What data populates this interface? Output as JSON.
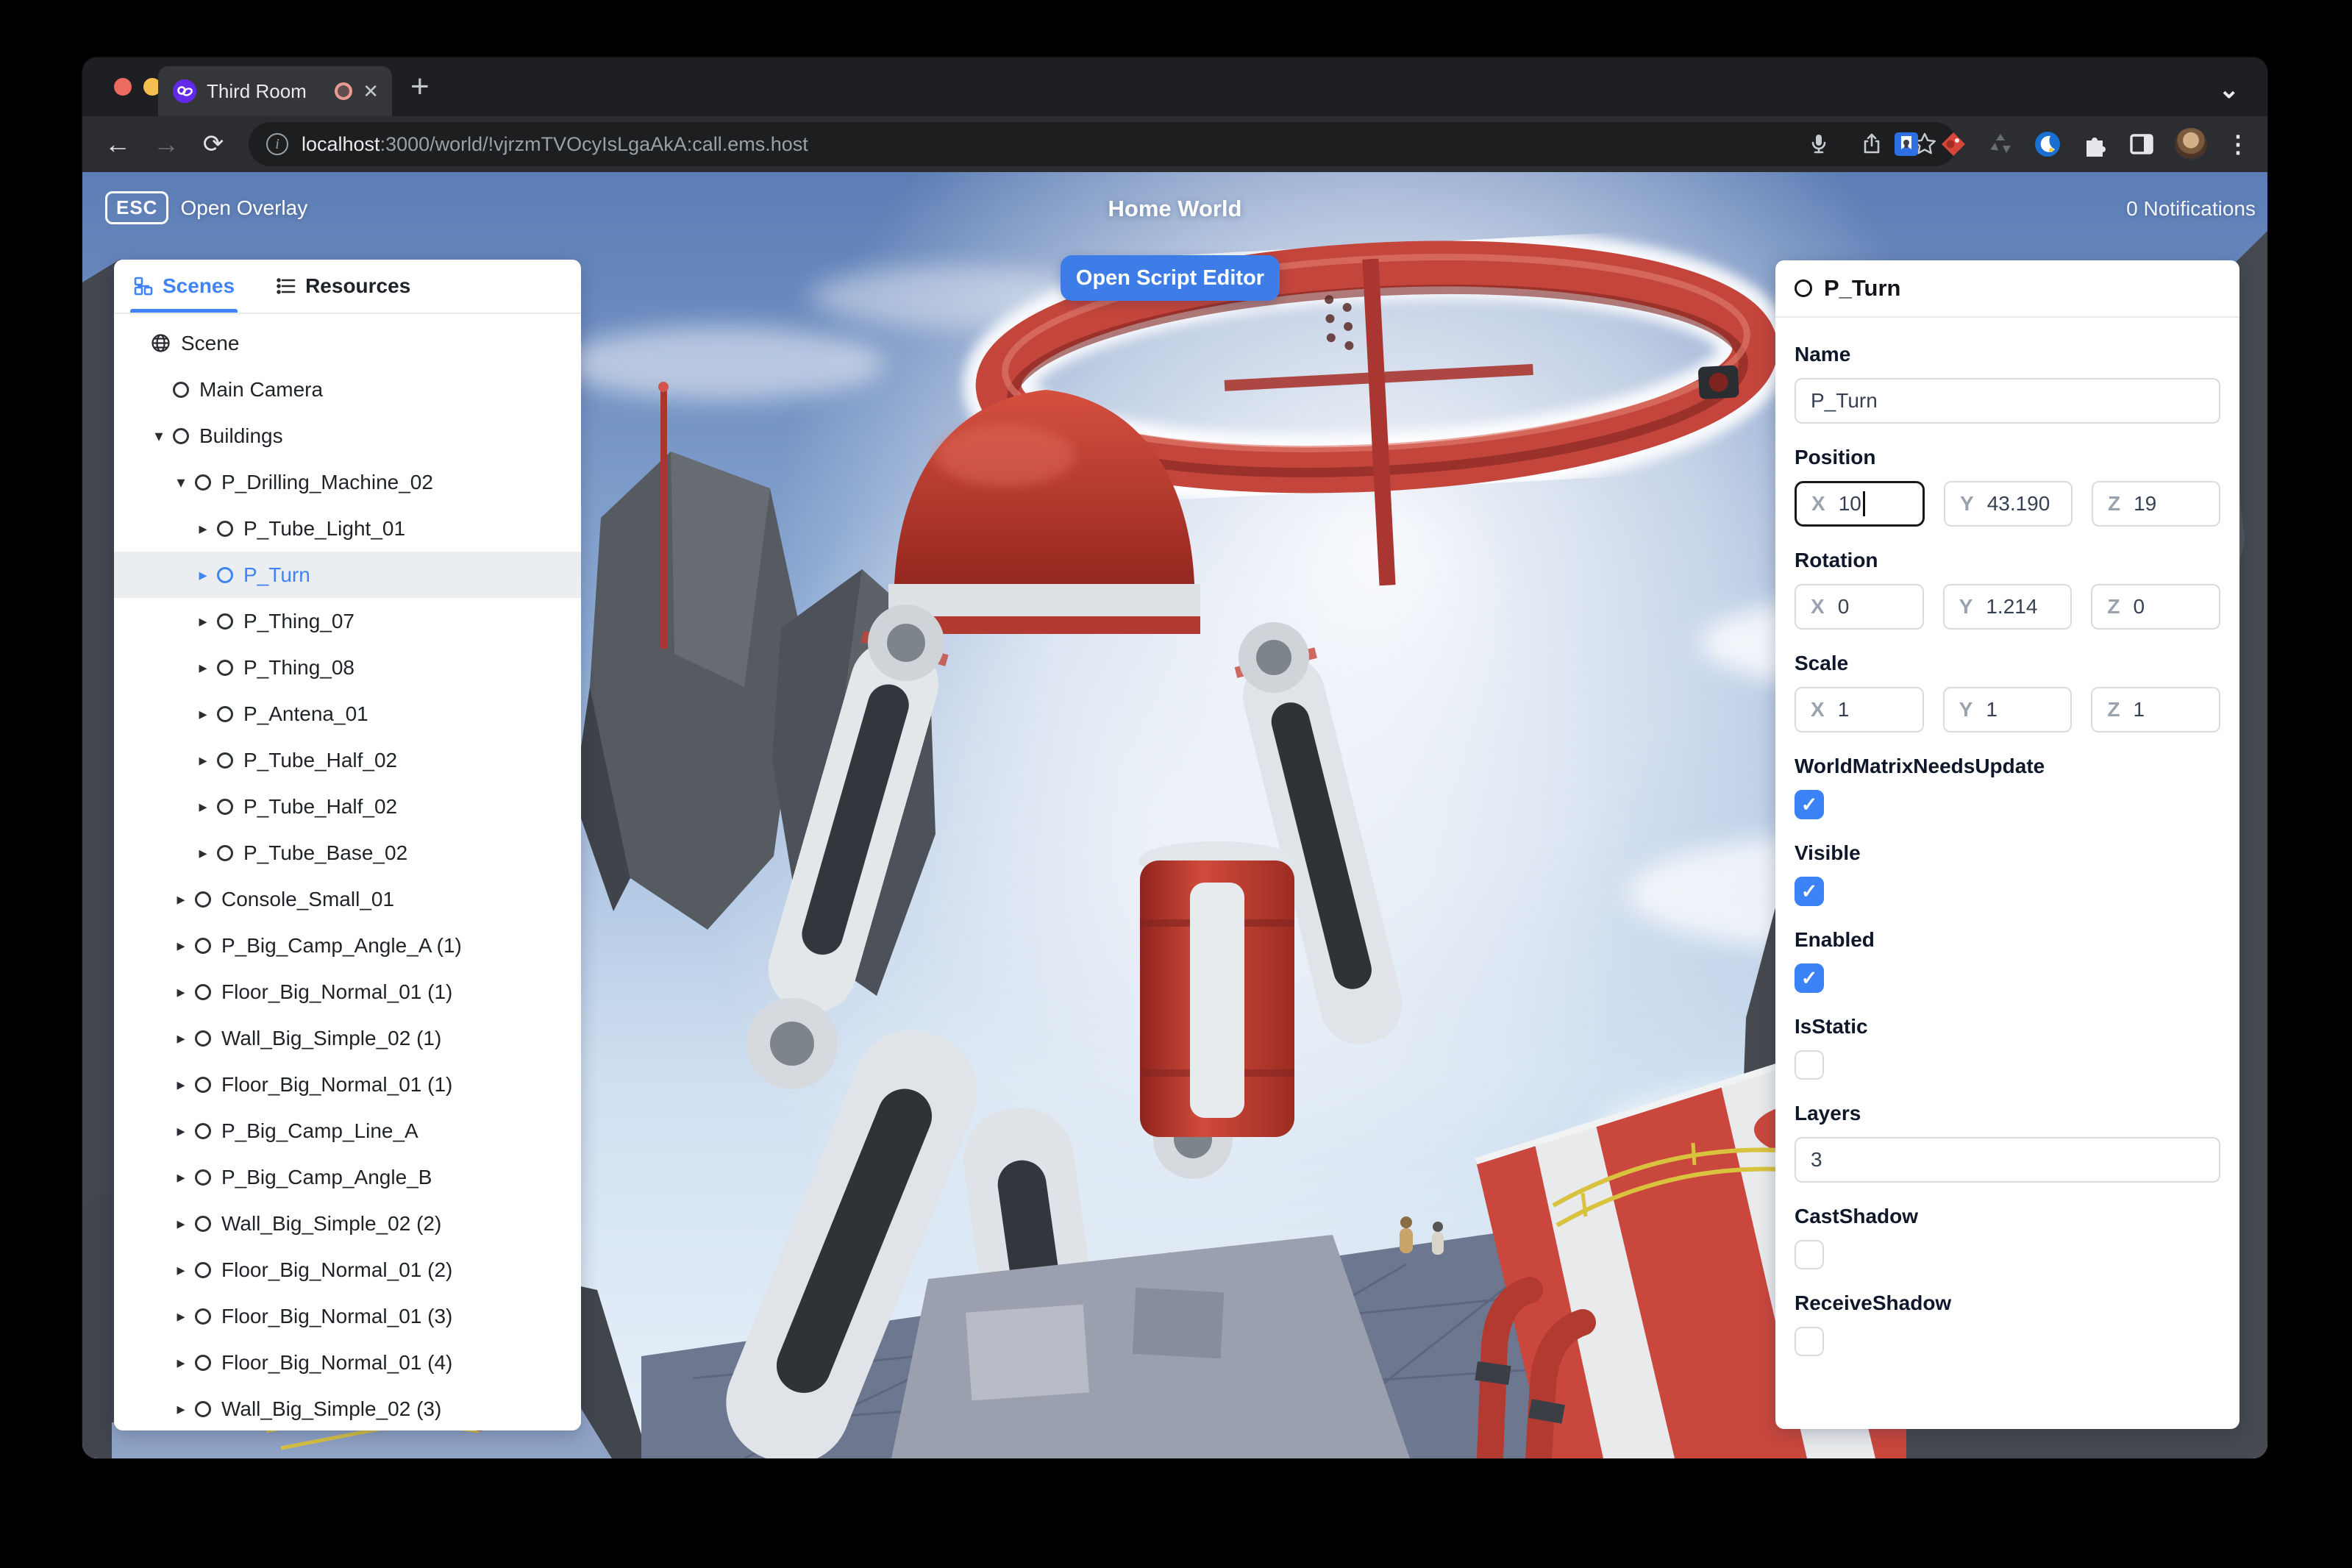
{
  "browser": {
    "tab": {
      "title": "Third Room"
    },
    "url": {
      "host": "localhost",
      "rest": ":3000/world/!vjrzmTVOcyIsLgaAkA:call.ems.host"
    },
    "icons": {
      "close": "✕",
      "new_tab": "+",
      "chevron_down": "⌄",
      "back": "←",
      "forward": "→",
      "reload": "⟳",
      "menu": "⋮",
      "info": "i"
    }
  },
  "overlay": {
    "esc_key": "ESC",
    "esc_label": "Open Overlay",
    "world_title": "Home World",
    "notifications": "0 Notifications",
    "open_script_editor": "Open Script Editor"
  },
  "scene_panel": {
    "tabs": [
      {
        "label": "Scenes",
        "active": true,
        "icon": "hierarchy-icon"
      },
      {
        "label": "Resources",
        "active": false,
        "icon": "list-icon"
      }
    ],
    "tree": [
      {
        "label": "Scene",
        "depth": 0,
        "icon": "globe",
        "toggle": null,
        "selected": false
      },
      {
        "label": "Main Camera",
        "depth": 1,
        "icon": "circle",
        "toggle": null,
        "selected": false
      },
      {
        "label": "Buildings",
        "depth": 1,
        "icon": "circle",
        "toggle": "open",
        "selected": false
      },
      {
        "label": "P_Drilling_Machine_02",
        "depth": 2,
        "icon": "circle",
        "toggle": "open",
        "selected": false
      },
      {
        "label": "P_Tube_Light_01",
        "depth": 3,
        "icon": "circle",
        "toggle": "closed",
        "selected": false
      },
      {
        "label": "P_Turn",
        "depth": 3,
        "icon": "circle",
        "toggle": "closed",
        "selected": true
      },
      {
        "label": "P_Thing_07",
        "depth": 3,
        "icon": "circle",
        "toggle": "closed",
        "selected": false
      },
      {
        "label": "P_Thing_08",
        "depth": 3,
        "icon": "circle",
        "toggle": "closed",
        "selected": false
      },
      {
        "label": "P_Antena_01",
        "depth": 3,
        "icon": "circle",
        "toggle": "closed",
        "selected": false
      },
      {
        "label": "P_Tube_Half_02",
        "depth": 3,
        "icon": "circle",
        "toggle": "closed",
        "selected": false
      },
      {
        "label": "P_Tube_Half_02",
        "depth": 3,
        "icon": "circle",
        "toggle": "closed",
        "selected": false
      },
      {
        "label": "P_Tube_Base_02",
        "depth": 3,
        "icon": "circle",
        "toggle": "closed",
        "selected": false
      },
      {
        "label": "Console_Small_01",
        "depth": 2,
        "icon": "circle",
        "toggle": "closed",
        "selected": false
      },
      {
        "label": "P_Big_Camp_Angle_A (1)",
        "depth": 2,
        "icon": "circle",
        "toggle": "closed",
        "selected": false
      },
      {
        "label": "Floor_Big_Normal_01 (1)",
        "depth": 2,
        "icon": "circle",
        "toggle": "closed",
        "selected": false
      },
      {
        "label": "Wall_Big_Simple_02 (1)",
        "depth": 2,
        "icon": "circle",
        "toggle": "closed",
        "selected": false
      },
      {
        "label": "Floor_Big_Normal_01 (1)",
        "depth": 2,
        "icon": "circle",
        "toggle": "closed",
        "selected": false
      },
      {
        "label": "P_Big_Camp_Line_A",
        "depth": 2,
        "icon": "circle",
        "toggle": "closed",
        "selected": false
      },
      {
        "label": "P_Big_Camp_Angle_B",
        "depth": 2,
        "icon": "circle",
        "toggle": "closed",
        "selected": false
      },
      {
        "label": "Wall_Big_Simple_02 (2)",
        "depth": 2,
        "icon": "circle",
        "toggle": "closed",
        "selected": false
      },
      {
        "label": "Floor_Big_Normal_01 (2)",
        "depth": 2,
        "icon": "circle",
        "toggle": "closed",
        "selected": false
      },
      {
        "label": "Floor_Big_Normal_01 (3)",
        "depth": 2,
        "icon": "circle",
        "toggle": "closed",
        "selected": false
      },
      {
        "label": "Floor_Big_Normal_01 (4)",
        "depth": 2,
        "icon": "circle",
        "toggle": "closed",
        "selected": false
      },
      {
        "label": "Wall_Big_Simple_02 (3)",
        "depth": 2,
        "icon": "circle",
        "toggle": "closed",
        "selected": false
      }
    ],
    "glyphs": {
      "open": "▾",
      "closed": "▸"
    }
  },
  "properties_panel": {
    "header": {
      "title": "P_Turn"
    },
    "sections": [
      {
        "kind": "text",
        "name": "name",
        "label": "Name",
        "value": "P_Turn"
      },
      {
        "kind": "vec3",
        "name": "position",
        "label": "Position",
        "axes": [
          {
            "axis": "X",
            "value": "10",
            "focused": true
          },
          {
            "axis": "Y",
            "value": "43.190",
            "focused": false
          },
          {
            "axis": "Z",
            "value": "19",
            "focused": false
          }
        ]
      },
      {
        "kind": "vec3",
        "name": "rotation",
        "label": "Rotation",
        "axes": [
          {
            "axis": "X",
            "value": "0",
            "focused": false
          },
          {
            "axis": "Y",
            "value": "1.214",
            "focused": false
          },
          {
            "axis": "Z",
            "value": "0",
            "focused": false
          }
        ]
      },
      {
        "kind": "vec3",
        "name": "scale",
        "label": "Scale",
        "axes": [
          {
            "axis": "X",
            "value": "1",
            "focused": false
          },
          {
            "axis": "Y",
            "value": "1",
            "focused": false
          },
          {
            "axis": "Z",
            "value": "1",
            "focused": false
          }
        ]
      },
      {
        "kind": "check",
        "name": "world-matrix-needs-update",
        "label": "WorldMatrixNeedsUpdate",
        "checked": true
      },
      {
        "kind": "check",
        "name": "visible",
        "label": "Visible",
        "checked": true
      },
      {
        "kind": "check",
        "name": "enabled",
        "label": "Enabled",
        "checked": true
      },
      {
        "kind": "check",
        "name": "is-static",
        "label": "IsStatic",
        "checked": false
      },
      {
        "kind": "text",
        "name": "layers",
        "label": "Layers",
        "value": "3"
      },
      {
        "kind": "check",
        "name": "cast-shadow",
        "label": "CastShadow",
        "checked": false
      },
      {
        "kind": "check",
        "name": "receive-shadow",
        "label": "ReceiveShadow",
        "checked": false
      }
    ],
    "check_glyph": "✓"
  },
  "colors": {
    "accent_blue": "#3E7DE7",
    "selection_blue": "#3F83F8",
    "checkbox_blue": "#3B82F6",
    "machine_red": "#C4453B",
    "tabstrip": "#1E1F22",
    "toolbar": "#2B2D30",
    "url_pill": "#1D1E20",
    "active_tab": "#35363A",
    "panel_bg": "#FFFFFF"
  }
}
